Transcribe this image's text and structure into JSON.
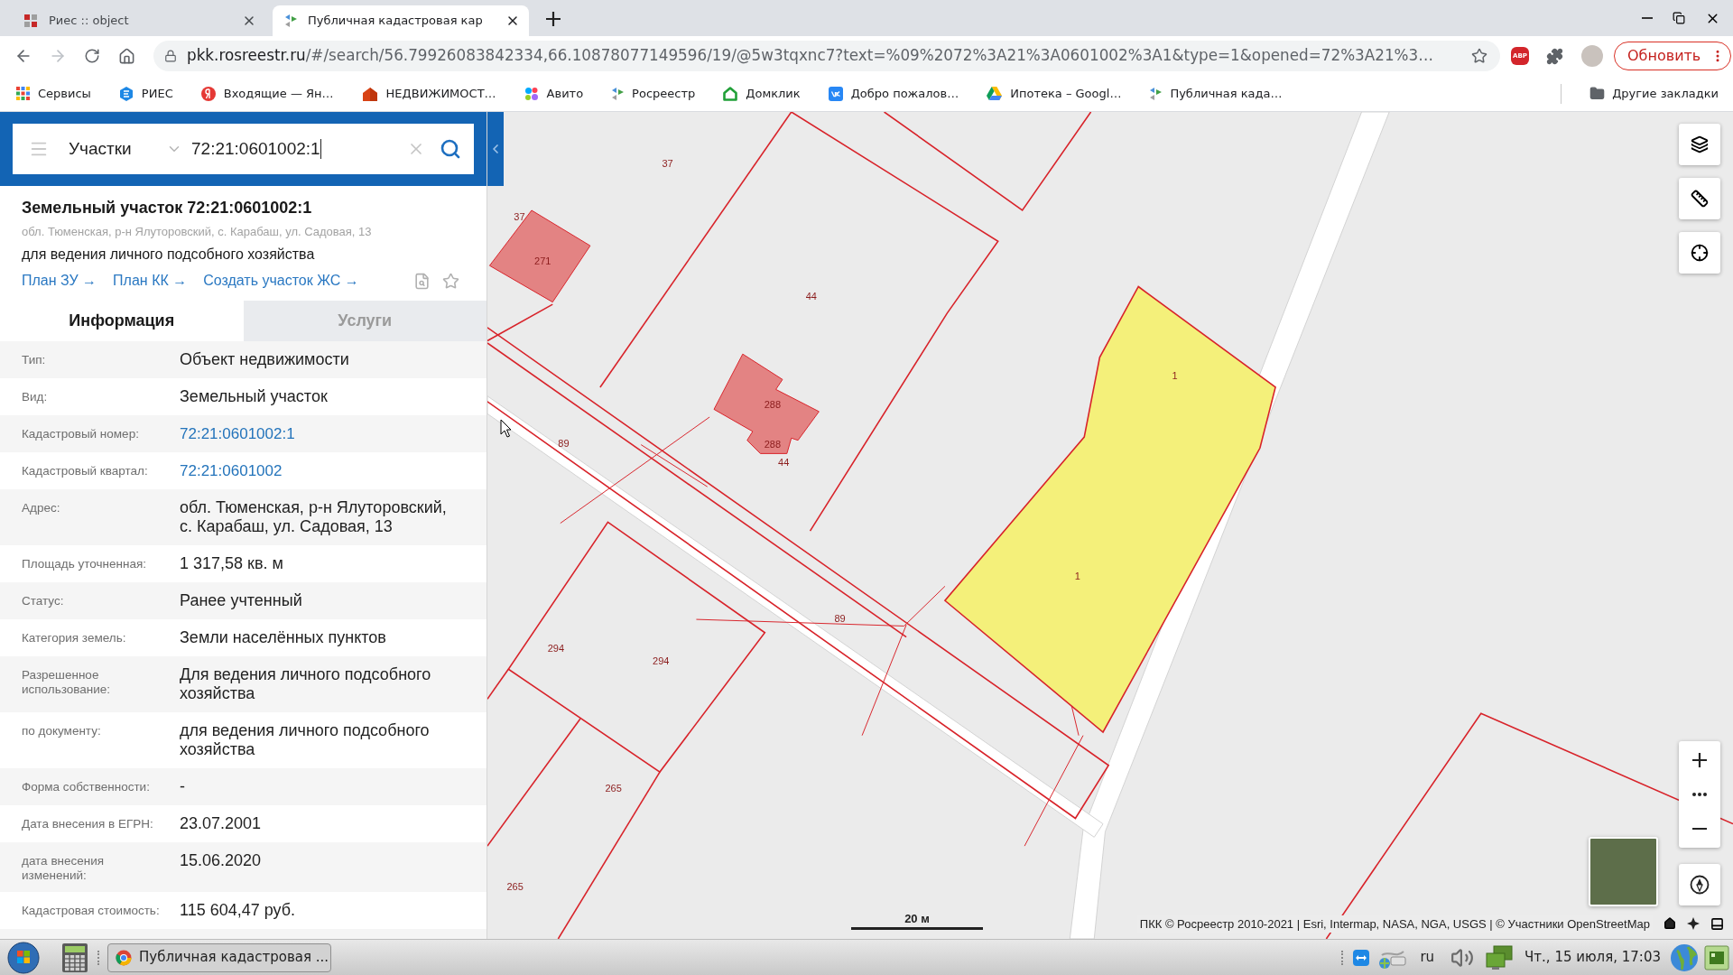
{
  "browser": {
    "tabs": [
      {
        "title": "Риес :: object",
        "selected": false,
        "kind": "squares"
      },
      {
        "title": "Публичная кадастровая кар",
        "selected": true,
        "kind": "leaf"
      }
    ],
    "url": {
      "host": "pkk.rosreestr.ru",
      "path": "/#/search/56.79926083842334,66.10878077149596/19/@5w3tqxnc7?text=%09%2072%3A21%3A0601002%3A1&type=1&opened=72%3A21%3…"
    },
    "adblock_label": "ABP",
    "update_button": "Обновить",
    "bookmarks": [
      {
        "label": "Сервисы",
        "kind": "apps"
      },
      {
        "label": "РИЕС",
        "kind": "ries"
      },
      {
        "label": "Входящие — Ян…",
        "kind": "yandex"
      },
      {
        "label": "НЕДВИЖИМОСТ…",
        "kind": "realty"
      },
      {
        "label": "Авито",
        "kind": "avito"
      },
      {
        "label": "Росреестр",
        "kind": "leaf"
      },
      {
        "label": "Домклик",
        "kind": "domclick"
      },
      {
        "label": "Добро пожалов…",
        "kind": "vk"
      },
      {
        "label": "Ипотека – Googl…",
        "kind": "drive"
      },
      {
        "label": "Публичная када…",
        "kind": "leaf"
      }
    ],
    "other_bookmarks": "Другие закладки"
  },
  "panel": {
    "search": {
      "layer": "Участки",
      "value": "72:21:0601002:1"
    },
    "object": {
      "title": "Земельный участок 72:21:0601002:1",
      "address": "обл. Тюменская, р-н Ялуторовский, с. Карабаш, ул. Садовая, 13",
      "purpose": "для ведения личного подсобного хозяйства",
      "links": [
        "План ЗУ →",
        "План КК →",
        "Создать участок ЖС →"
      ]
    },
    "tabs": [
      {
        "label": "Информация",
        "selected": true
      },
      {
        "label": "Услуги",
        "selected": false
      }
    ],
    "fields": [
      {
        "label": "Тип:",
        "value": "Объект недвижимости",
        "kind": "text"
      },
      {
        "label": "Вид:",
        "value": "Земельный участок",
        "kind": "text"
      },
      {
        "label": "Кадастровый номер:",
        "value": "72:21:0601002:1",
        "kind": "link"
      },
      {
        "label": "Кадастровый квартал:",
        "value": "72:21:0601002",
        "kind": "link"
      },
      {
        "label": "Адрес:",
        "value": "обл. Тюменская, р-н Ялуторовский, с. Карабаш, ул. Садовая, 13",
        "kind": "text"
      },
      {
        "label": "Площадь уточненная:",
        "value": "1 317,58 кв. м",
        "kind": "text"
      },
      {
        "label": "Статус:",
        "value": "Ранее учтенный",
        "kind": "text"
      },
      {
        "label": "Категория земель:",
        "value": "Земли населённых пунктов",
        "kind": "text"
      },
      {
        "label": "Разрешенное использование:",
        "value": "Для ведения личного подсобного хозяйства",
        "kind": "text"
      },
      {
        "label": "по документу:",
        "value": "для ведения личного подсобного хозяйства",
        "kind": "text"
      },
      {
        "label": "Форма собственности:",
        "value": "-",
        "kind": "text"
      },
      {
        "label": "Дата внесения в ЕГРН:",
        "value": "23.07.2001",
        "kind": "text"
      },
      {
        "label": "дата внесения изменений:",
        "value": "15.06.2020",
        "kind": "text"
      },
      {
        "label": "Кадастровая стоимость:",
        "value": "115 604,47 руб.",
        "kind": "text"
      }
    ]
  },
  "map": {
    "labels": [
      "37",
      "37",
      "271",
      "44",
      "288",
      "288",
      "44",
      "89",
      "89",
      "294",
      "294",
      "265",
      "265",
      "1",
      "1"
    ],
    "scale": "20 м",
    "attribution": "ПКК © Росреестр 2010-2021 | Esri, Intermap, NASA, NGA, USGS | © Участники OpenStreetMap"
  },
  "taskbar": {
    "task": "Публичная кадастровая ...",
    "language": "ru",
    "clock": "Чт., 15 июля, 17:03"
  }
}
